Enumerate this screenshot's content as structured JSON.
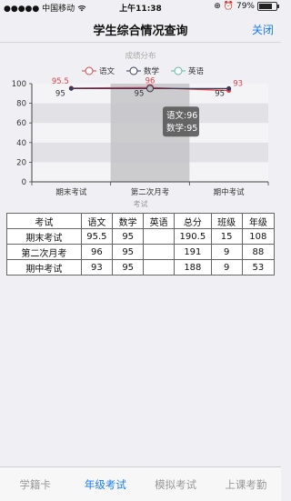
{
  "status_bar": {
    "carrier": "●●●●● 中国移动",
    "wifi": "wifi-icon",
    "time": "上午11:38",
    "battery_pct": "79%",
    "battery_level": 0.79
  },
  "nav": {
    "title": "学生综合情况查询",
    "close_label": "关闭"
  },
  "chart_data": {
    "type": "line",
    "title": "成绩分布",
    "xlabel": "考试",
    "categories": [
      "期末考试",
      "第二次月考",
      "期中考试"
    ],
    "ylim": [
      0,
      100
    ],
    "yticks": [
      0,
      20,
      40,
      60,
      80,
      100
    ],
    "highlighted_category": "第二次月考",
    "grid": true,
    "legend_position": "top",
    "series": [
      {
        "name": "语文",
        "values": [
          95.5,
          96,
          93
        ],
        "color": "#d9434a",
        "labels": [
          "95.5",
          "96",
          "93"
        ]
      },
      {
        "name": "数学",
        "values": [
          95,
          95,
          95
        ],
        "color": "#3a3a5a",
        "labels": [
          "95",
          "95",
          "95"
        ]
      },
      {
        "name": "英语",
        "values": [
          null,
          null,
          null
        ],
        "color": "#5fb8a8",
        "labels": []
      }
    ],
    "tooltip": {
      "lines": [
        "语文:96",
        "数学:95"
      ]
    }
  },
  "table": {
    "headers": [
      "考试",
      "语文",
      "数学",
      "英语",
      "总分",
      "班级",
      "年级"
    ],
    "rows": [
      [
        "期末考试",
        "95.5",
        "95",
        "",
        "190.5",
        "15",
        "108"
      ],
      [
        "第二次月考",
        "96",
        "95",
        "",
        "191",
        "9",
        "88"
      ],
      [
        "期中考试",
        "93",
        "95",
        "",
        "188",
        "9",
        "53"
      ]
    ]
  },
  "tabs": [
    {
      "label": "学籍卡",
      "active": false
    },
    {
      "label": "年级考试",
      "active": true
    },
    {
      "label": "模拟考试",
      "active": false
    },
    {
      "label": "上课考勤",
      "active": false
    }
  ]
}
